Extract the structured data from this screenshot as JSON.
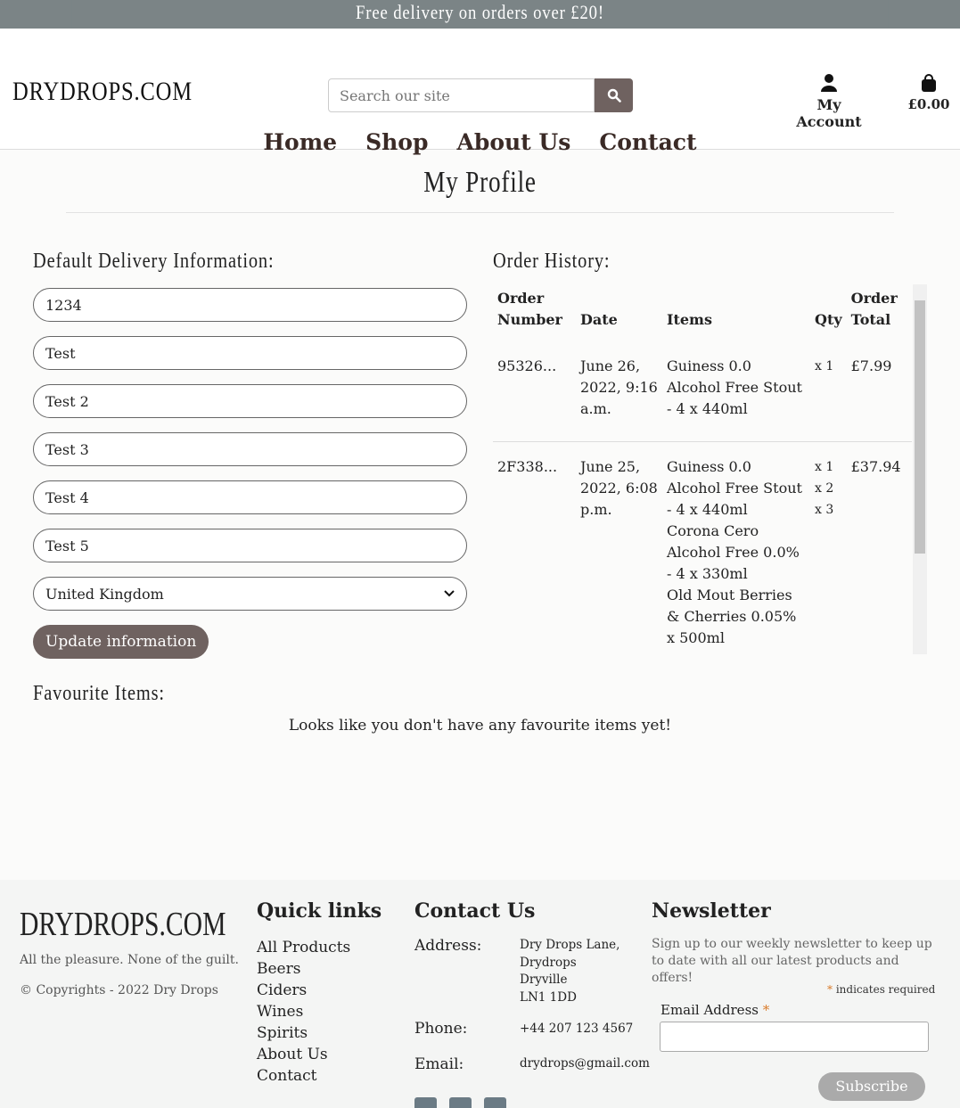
{
  "banner": {
    "text": "Free delivery on orders over £20!"
  },
  "header": {
    "logo": "DRYDROPS.COM",
    "search_placeholder": "Search our site",
    "account_label": "My Account",
    "cart_total": "£0.00",
    "nav": [
      "Home",
      "Shop",
      "About Us",
      "Contact"
    ]
  },
  "page": {
    "title": "My Profile"
  },
  "delivery": {
    "heading": "Default Delivery Information:",
    "fields": [
      "1234",
      "Test",
      "Test 2",
      "Test 3",
      "Test 4",
      "Test 5"
    ],
    "country": "United Kingdom",
    "update_label": "Update information"
  },
  "orders": {
    "heading": "Order History:",
    "columns": {
      "number": "Order Number",
      "date": "Date",
      "items": "Items",
      "qty": "Qty",
      "total": "Order Total"
    },
    "rows": [
      {
        "number": "95326...",
        "date": "June 26, 2022, 9:16 a.m.",
        "items": [
          "Guiness 0.0 Alcohol Free Stout - 4 x 440ml"
        ],
        "qty": [
          "x 1"
        ],
        "total": "£7.99"
      },
      {
        "number": "2F338...",
        "date": "June 25, 2022, 6:08 p.m.",
        "items": [
          "Guiness 0.0 Alcohol Free Stout - 4 x 440ml",
          "Corona Cero Alcohol Free 0.0% - 4 x 330ml",
          "Old Mout Berries & Cherries 0.05% x 500ml"
        ],
        "qty": [
          "x 1",
          "x 2",
          "x 3"
        ],
        "total": "£37.94"
      }
    ]
  },
  "favourites": {
    "heading": "Favourite Items:",
    "empty_message": "Looks like you don't have any favourite items yet!"
  },
  "footer": {
    "logo": "DRYDROPS.COM",
    "tagline": "All the pleasure. None of the guilt.",
    "copyright": "© Copyrights - 2022 Dry Drops",
    "quick_links_heading": "Quick links",
    "quick_links": [
      "All Products",
      "Beers",
      "Ciders",
      "Wines",
      "Spirits",
      "About Us",
      "Contact"
    ],
    "contact_heading": "Contact Us",
    "address_label": "Address:",
    "address_lines": [
      "Dry Drops Lane,",
      "Drydrops",
      "Dryville",
      "LN1 1DD"
    ],
    "phone_label": "Phone:",
    "phone": "+44 207 123 4567",
    "email_label": "Email:",
    "email": "drydrops@gmail.com",
    "newsletter_heading": "Newsletter",
    "newsletter_text": "Sign up to our weekly newsletter to keep up to date with all our latest products and offers!",
    "required_note": "indicates required",
    "email_field_label": "Email Address",
    "subscribe_label": "Subscribe"
  }
}
